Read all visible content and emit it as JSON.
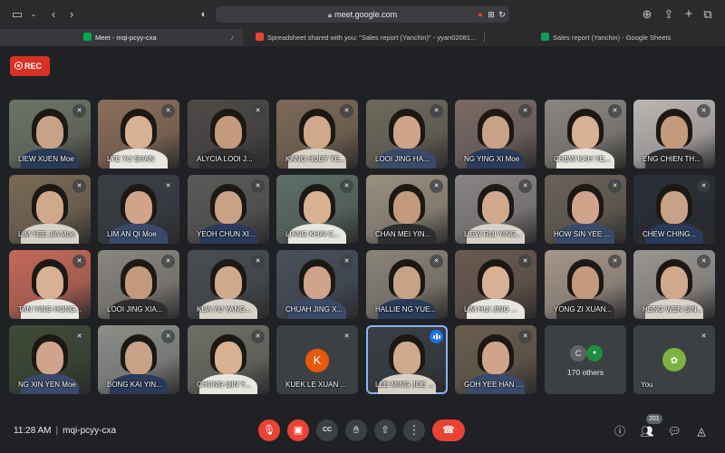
{
  "browser": {
    "url": "meet.google.com",
    "tabs": [
      {
        "label": "Meet - mqi-pcyy-cxa",
        "active": true,
        "favicon_color": "#00ac47"
      },
      {
        "label": "Spreadsheet shared with you: \"Sales report (Yanchin)\" - yyan02081...",
        "active": false,
        "favicon_color": "#ea4335"
      },
      {
        "label": "Sales report (Yanchin) - Google Sheets",
        "active": false,
        "favicon_color": "#0f9d58"
      }
    ]
  },
  "recording": {
    "label": "REC"
  },
  "participants": [
    {
      "name": "LIEW XUEN Moe"
    },
    {
      "name": "LYE YU SHAN"
    },
    {
      "name": "ALYCIA LOOI J..."
    },
    {
      "name": "KANG HUEY YE..."
    },
    {
      "name": "LOOI JING HA..."
    },
    {
      "name": "NG YING XI Moe"
    },
    {
      "name": "CHEW KAH YE..."
    },
    {
      "name": "ENG CHIEN TH..."
    },
    {
      "name": "LIM YEE JIA Moe"
    },
    {
      "name": "LIM AN QI Moe"
    },
    {
      "name": "YEOH CHUN XI..."
    },
    {
      "name": "LIANG KHAI C..."
    },
    {
      "name": "CHAN MEI YIN..."
    },
    {
      "name": "LIEW RUI YING..."
    },
    {
      "name": "HOW SIN YEE ..."
    },
    {
      "name": "CHEW CHING..."
    },
    {
      "name": "TAN YING HONG..."
    },
    {
      "name": "LOOI JING XIA..."
    },
    {
      "name": "KUA YU YANG..."
    },
    {
      "name": "CHUAH JING X..."
    },
    {
      "name": "HALLIE NG YUE..."
    },
    {
      "name": "LIM HUI JING ..."
    },
    {
      "name": "YONG ZI XUAN..."
    },
    {
      "name": "HENG WEN SIN..."
    },
    {
      "name": "NG XIN YEN Moe"
    },
    {
      "name": "BONG KAI YIN..."
    },
    {
      "name": "CHONG QIN Y..."
    },
    {
      "name": "KUEK LE XUAN ...",
      "avatar_letter": "K",
      "avatar_color": "#e8590c"
    },
    {
      "name": "LEE MING JOE ...",
      "speaking": true
    },
    {
      "name": "GOH YEE HAN ..."
    }
  ],
  "others": {
    "label": "170 others",
    "avatar_letter": "C"
  },
  "self": {
    "label": "You"
  },
  "meeting": {
    "time": "11:28 AM",
    "separator": "|",
    "code": "mqi-pcyy-cxa"
  },
  "people_count": "201",
  "colors": {
    "accent_red": "#ea4335",
    "rec_red": "#d93025",
    "speaker_blue": "#1a73e8",
    "tile_gray": "#3c4043"
  }
}
